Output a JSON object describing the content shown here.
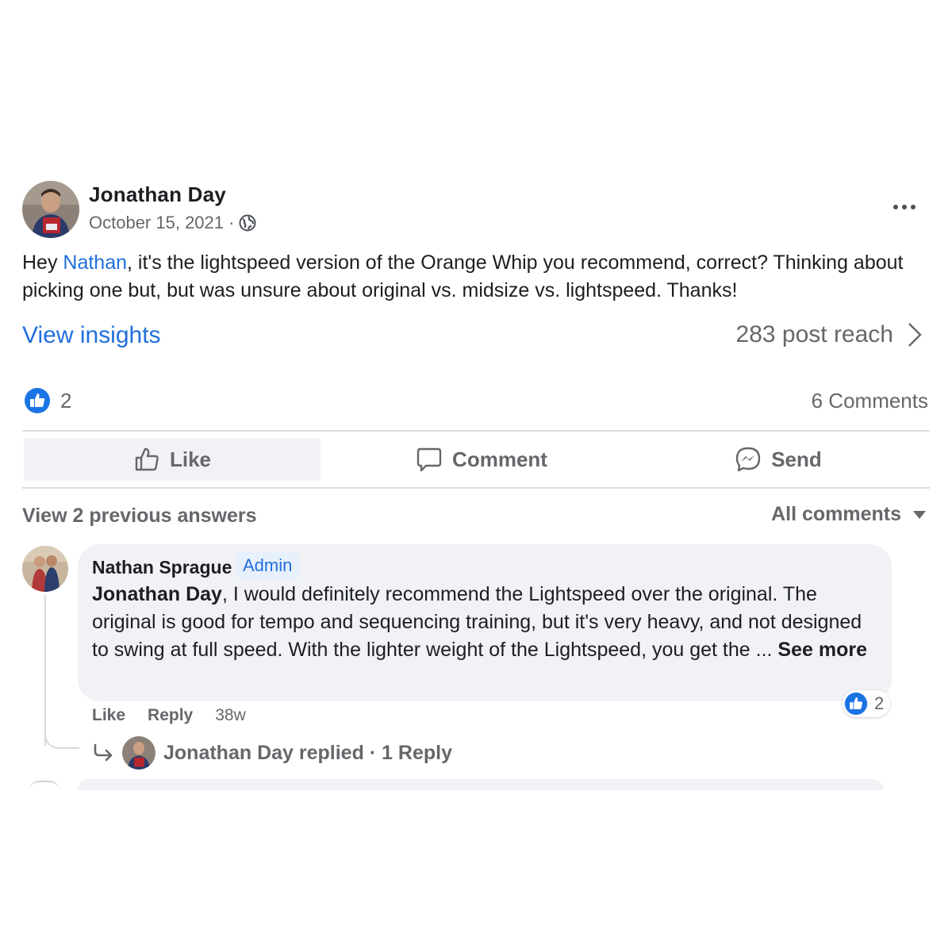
{
  "post": {
    "author": "Jonathan Day",
    "date": "October 15, 2021 ·",
    "privacy_icon": "globe-icon",
    "text_before": "Hey ",
    "mention": "Nathan",
    "text_after": ", it's the lightspeed version of the Orange Whip you recommend, correct? Thinking about picking one but, but was unsure about original vs. midsize vs. lightspeed. Thanks!",
    "insights_label": "View insights",
    "reach_label": "283 post reach",
    "reaction_count": "2",
    "comments_label": "6 Comments"
  },
  "actions": {
    "like": "Like",
    "comment": "Comment",
    "send": "Send"
  },
  "comments_header": {
    "previous": "View 2 previous answers",
    "filter": "All comments"
  },
  "comment": {
    "author": "Nathan Sprague",
    "badge": "Admin",
    "mention": "Jonathan Day",
    "text": ", I would definitely recommend the Lightspeed over the original. The original is good for tempo and sequencing training, but it's very heavy, and not designed to swing at full speed. With the lighter weight of the Lightspeed, you get the ... ",
    "see_more": "See more",
    "reaction_count": "2",
    "like_action": "Like",
    "reply_action": "Reply",
    "time": "38w",
    "reply_summary": "Jonathan Day replied · 1 Reply"
  },
  "colors": {
    "accent": "#216fdb",
    "muted": "#65676b",
    "bubble": "#f0f2f5",
    "like_blue": "#1b74e4"
  }
}
